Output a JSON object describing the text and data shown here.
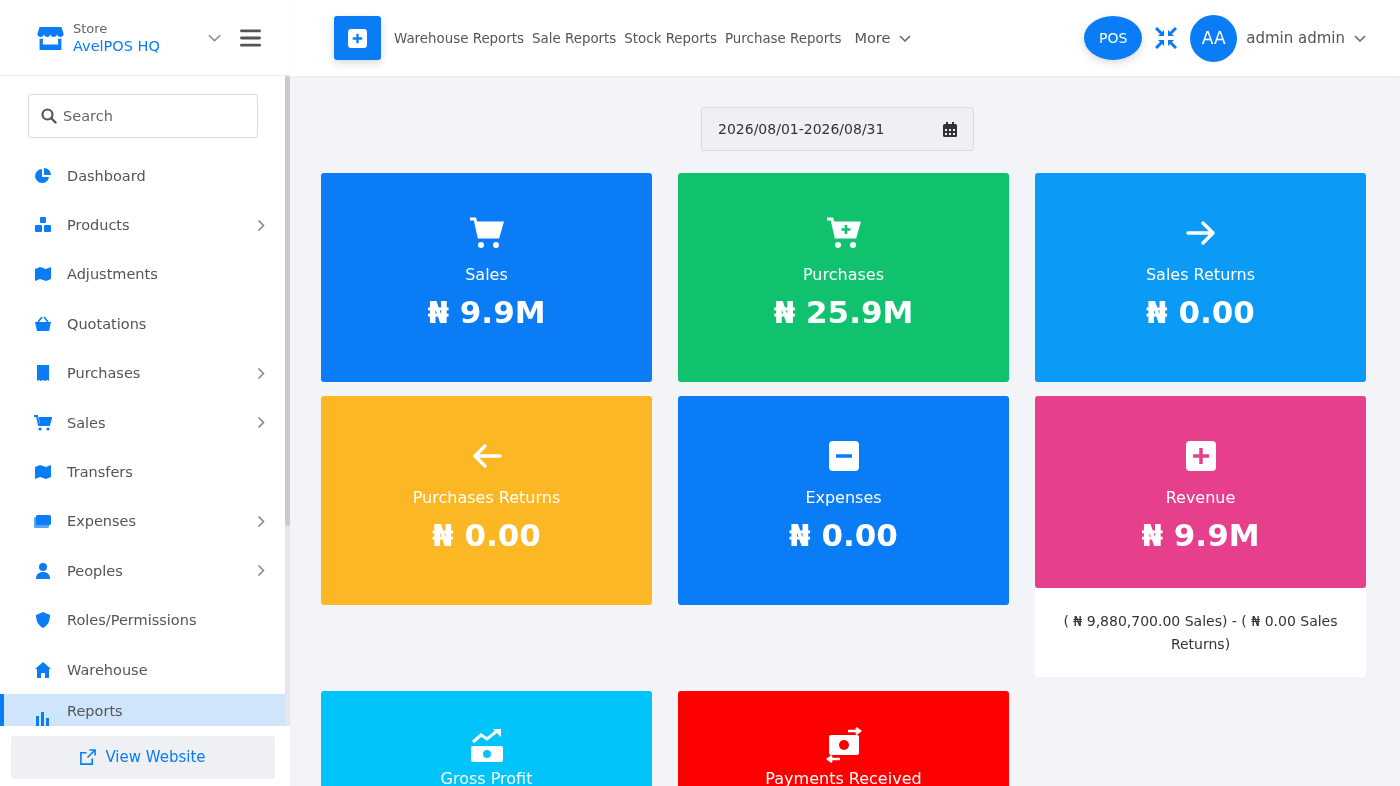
{
  "store": {
    "label": "Store",
    "name": "AvelPOS HQ"
  },
  "nav_links": [
    "Warehouse Reports",
    "Sale Reports",
    "Stock Reports",
    "Purchase Reports"
  ],
  "more_menu": {
    "label": "More"
  },
  "pos_button": {
    "label": "POS"
  },
  "user": {
    "initials": "AA",
    "name": "admin admin"
  },
  "search": {
    "placeholder": "Search"
  },
  "sidebar": {
    "items": [
      {
        "label": "Dashboard",
        "expandable": false,
        "selected": false
      },
      {
        "label": "Products",
        "expandable": true,
        "selected": false
      },
      {
        "label": "Adjustments",
        "expandable": false,
        "selected": false
      },
      {
        "label": "Quotations",
        "expandable": false,
        "selected": false
      },
      {
        "label": "Purchases",
        "expandable": true,
        "selected": false
      },
      {
        "label": "Sales",
        "expandable": true,
        "selected": false
      },
      {
        "label": "Transfers",
        "expandable": false,
        "selected": false
      },
      {
        "label": "Expenses",
        "expandable": true,
        "selected": false
      },
      {
        "label": "Peoples",
        "expandable": true,
        "selected": false
      },
      {
        "label": "Roles/Permissions",
        "expandable": false,
        "selected": false
      },
      {
        "label": "Warehouse",
        "expandable": false,
        "selected": false
      },
      {
        "label": "Reports",
        "expandable": false,
        "selected": true
      }
    ],
    "footer_link": "View Website"
  },
  "date_range": "2026/08/01-2026/08/31",
  "cards": [
    {
      "title": "Sales",
      "value": "₦ 9.9M",
      "color": "#0a7cf5"
    },
    {
      "title": "Purchases",
      "value": "₦ 25.9M",
      "color": "#10c16e"
    },
    {
      "title": "Sales Returns",
      "value": "₦ 0.00",
      "color": "#0b9af5"
    },
    {
      "title": "Purchases Returns",
      "value": "₦ 0.00",
      "color": "#fcb724"
    },
    {
      "title": "Expenses",
      "value": "₦ 0.00",
      "color": "#0a7cf5"
    },
    {
      "title": "Revenue",
      "value": "₦ 9.9M",
      "color": "#e63f8c",
      "note": "( ₦ 9,880,700.00 Sales) - ( ₦ 0.00 Sales Returns)"
    },
    {
      "title": "Gross Profit",
      "color": "#00c4fa"
    },
    {
      "title": "Payments Received",
      "color": "#ff0000"
    }
  ]
}
